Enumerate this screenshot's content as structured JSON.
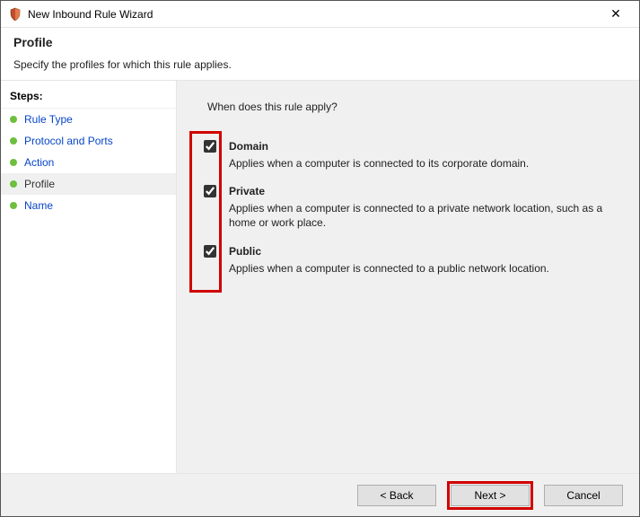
{
  "window": {
    "title": "New Inbound Rule Wizard",
    "close_glyph": "✕"
  },
  "header": {
    "title": "Profile",
    "subtitle": "Specify the profiles for which this rule applies."
  },
  "sidebar": {
    "heading": "Steps:",
    "items": [
      {
        "label": "Rule Type",
        "bullet": "#6fbf3f",
        "current": false
      },
      {
        "label": "Protocol and Ports",
        "bullet": "#6fbf3f",
        "current": false
      },
      {
        "label": "Action",
        "bullet": "#6fbf3f",
        "current": false
      },
      {
        "label": "Profile",
        "bullet": "#6fbf3f",
        "current": true
      },
      {
        "label": "Name",
        "bullet": "#6fbf3f",
        "current": false
      }
    ]
  },
  "content": {
    "question": "When does this rule apply?",
    "options": [
      {
        "key": "domain",
        "label": "Domain",
        "checked": true,
        "desc": "Applies when a computer is connected to its corporate domain."
      },
      {
        "key": "private",
        "label": "Private",
        "checked": true,
        "desc": "Applies when a computer is connected to a private network location, such as a home or work place."
      },
      {
        "key": "public",
        "label": "Public",
        "checked": true,
        "desc": "Applies when a computer is connected to a public network location."
      }
    ]
  },
  "footer": {
    "back_label": "< Back",
    "next_label": "Next >",
    "cancel_label": "Cancel"
  },
  "highlight": {
    "checkbox_column": true,
    "next_button": true
  }
}
